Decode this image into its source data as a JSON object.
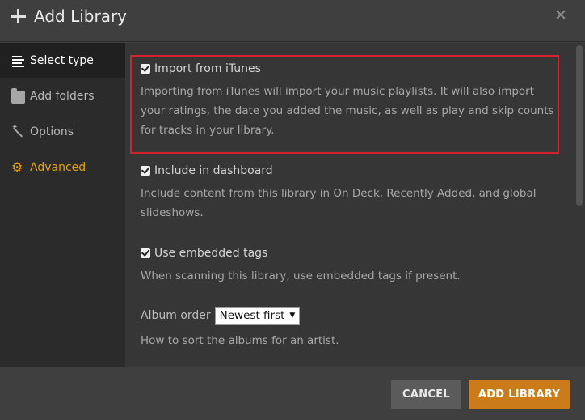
{
  "dialog": {
    "title": "Add Library",
    "close_glyph": "×"
  },
  "sidebar": {
    "items": [
      {
        "label": "Select type",
        "icon": "list-icon"
      },
      {
        "label": "Add folders",
        "icon": "folder-icon"
      },
      {
        "label": "Options",
        "icon": "wand-icon"
      },
      {
        "label": "Advanced",
        "icon": "gear-icon"
      }
    ]
  },
  "options": {
    "itunes": {
      "label": "Import from iTunes",
      "checked": true,
      "description": "Importing from iTunes will import your music playlists. It will also import your ratings, the date you added the music, as well as play and skip counts for tracks in your library."
    },
    "dashboard": {
      "label": "Include in dashboard",
      "checked": true,
      "description": "Include content from this library in On Deck, Recently Added, and global slideshows."
    },
    "embedded_tags": {
      "label": "Use embedded tags",
      "checked": true,
      "description": "When scanning this library, use embedded tags if present."
    },
    "album_order": {
      "label": "Album order",
      "selected": "Newest first",
      "description": "How to sort the albums for an artist."
    }
  },
  "footer": {
    "cancel_label": "CANCEL",
    "add_label": "ADD LIBRARY"
  },
  "colors": {
    "accent": "#e5a00d",
    "primary_button": "#cc7b19",
    "highlight_border": "#d6222a"
  }
}
